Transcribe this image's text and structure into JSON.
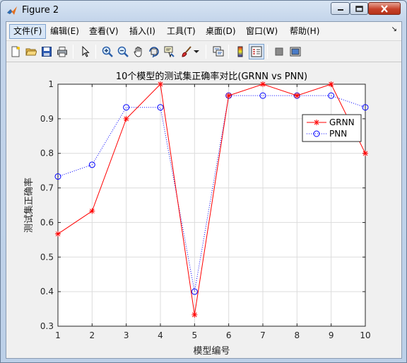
{
  "window": {
    "title": "Figure 2",
    "app_icon": "matlab-icon",
    "controls": [
      "minimize-icon",
      "maximize-icon",
      "close-icon"
    ]
  },
  "menu": {
    "items": [
      {
        "label": "文件(F)",
        "active": true
      },
      {
        "label": "编辑(E)"
      },
      {
        "label": "查看(V)"
      },
      {
        "label": "插入(I)"
      },
      {
        "label": "工具(T)"
      },
      {
        "label": "桌面(D)"
      },
      {
        "label": "窗口(W)"
      },
      {
        "label": "帮助(H)"
      }
    ],
    "dock_arrow": "↘"
  },
  "toolbar": {
    "buttons": [
      "new-figure-icon",
      "open-icon",
      "save-icon",
      "print-icon",
      "pointer-icon",
      "zoom-in-icon",
      "zoom-out-icon",
      "pan-icon",
      "rotate-icon",
      "data-cursor-icon",
      "brush-icon",
      "brush-dropdown-icon",
      "link-plot-icon",
      "colorbar-icon",
      "legend-icon",
      "hide-plot-tools-icon",
      "show-plot-tools-icon"
    ]
  },
  "chart_data": {
    "type": "line",
    "title": "10个模型的测试集正确率对比(GRNN vs PNN)",
    "xlabel": "模型编号",
    "ylabel": "测试集正确率",
    "x": [
      1,
      2,
      3,
      4,
      5,
      6,
      7,
      8,
      9,
      10
    ],
    "xlim": [
      1,
      10
    ],
    "ylim": [
      0.3,
      1
    ],
    "xticks": [
      "1",
      "2",
      "3",
      "4",
      "5",
      "6",
      "7",
      "8",
      "9",
      "10"
    ],
    "yticks": [
      "0.3",
      "0.4",
      "0.5",
      "0.6",
      "0.7",
      "0.8",
      "0.9",
      "1"
    ],
    "grid": true,
    "legend_position": "top-right",
    "series": [
      {
        "name": "GRNN",
        "values": [
          0.567,
          0.633,
          0.9,
          1.0,
          0.333,
          0.967,
          1.0,
          0.967,
          1.0,
          0.8
        ],
        "color": "#ff0000",
        "line": "solid",
        "marker": "star"
      },
      {
        "name": "PNN",
        "values": [
          0.733,
          0.767,
          0.933,
          0.933,
          0.4,
          0.967,
          0.967,
          0.967,
          0.967,
          0.933
        ],
        "color": "#0000ff",
        "line": "dotted",
        "marker": "circle"
      }
    ]
  }
}
